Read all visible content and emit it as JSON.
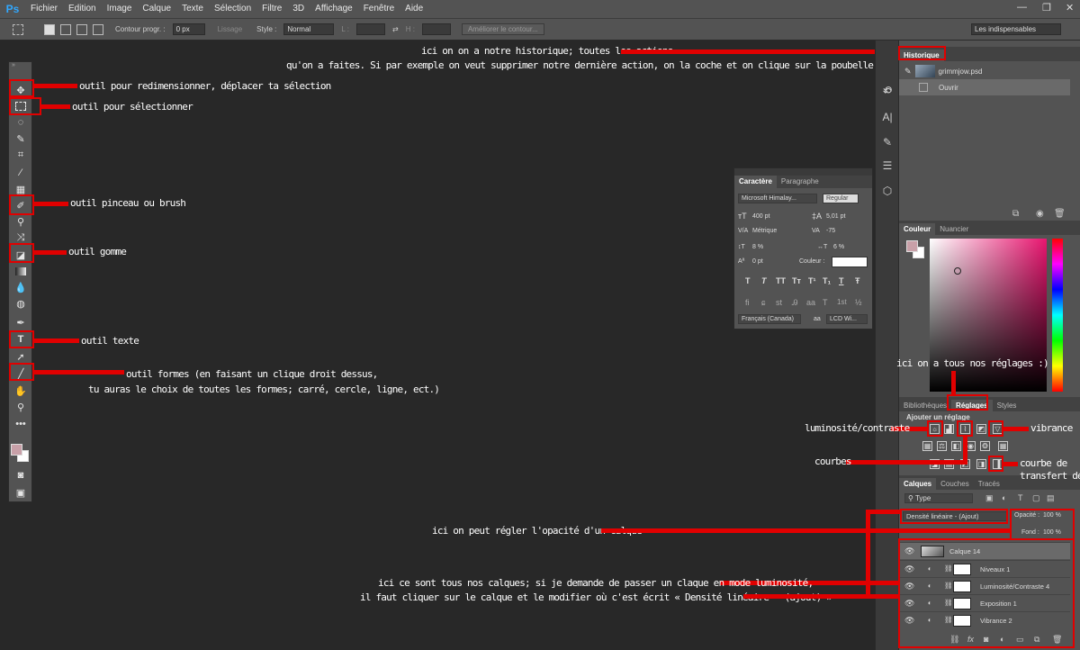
{
  "app": {
    "logo": "Ps"
  },
  "menu": [
    "Fichier",
    "Edition",
    "Image",
    "Calque",
    "Texte",
    "Sélection",
    "Filtre",
    "3D",
    "Affichage",
    "Fenêtre",
    "Aide"
  ],
  "window_controls": {
    "minimize": "—",
    "restore": "❐",
    "close": "✕"
  },
  "options_bar": {
    "feather_label": "Contour progr. :",
    "feather_value": "0 px",
    "antialias_label": "Lissage",
    "style_label": "Style :",
    "style_value": "Normal",
    "width_label": "L :",
    "height_label": "H :",
    "refine_button": "Améliorer le contour...",
    "workspace": "Les indispensables"
  },
  "annotations": {
    "move": "outil pour redimensionner, déplacer ta sélection",
    "select": "outil pour sélectionner",
    "brush": "outil pinceau ou brush",
    "eraser": "outil gomme",
    "text": "outil texte",
    "shapes_1": "outil formes (en faisant un clique droit dessus,",
    "shapes_2": "tu auras le choix de toutes les formes; carré, cercle, ligne, ect.)",
    "history_1": "ici on on a notre historique; toutes les actions",
    "history_2": "qu'on a faites. Si par exemple on veut supprimer notre dernière action, on la coche et on clique sur la poubelle.",
    "adjustments": "ici on a tous nos réglages :)",
    "brightness": "luminosité/contraste",
    "vibrance": "vibrance",
    "curves": "courbes",
    "gradient_1": "courbe de",
    "gradient_2": "transfert dégradé",
    "opacity": "ici on peut régler l'opacité d'un calque",
    "layers_1": "ici ce sont tous nos calques; si je demande de passer un claque en mode luminosité,",
    "layers_2": "il faut cliquer sur le calque et le modifier où c'est écrit « Densité linéaire - (ajout) »"
  },
  "history_panel": {
    "tab": "Historique",
    "snapshot": "grimmjow.psd",
    "rows": [
      "Ouvrir"
    ]
  },
  "character_panel": {
    "tabs": [
      "Caractère",
      "Paragraphe"
    ],
    "font": "Microsoft Himalay...",
    "style": "Regular",
    "size": "400 pt",
    "leading": "5,01 pt",
    "kerning": "Métrique",
    "tracking": "-75",
    "vscale": "8 %",
    "hscale": "6 %",
    "baseline": "0 pt",
    "color_label": "Couleur :",
    "format_buttons": [
      "T",
      "T",
      "TT",
      "Tт",
      "T¹",
      "T₁",
      "T",
      "Ŧ"
    ],
    "opentype_buttons": [
      "fi",
      "ɕ",
      "st",
      "Ꭿ",
      "aa",
      "T",
      "1st",
      "½"
    ],
    "language": "Français (Canada)",
    "aa_label": "aa",
    "antialias": "LCD Wi..."
  },
  "color_panel": {
    "tabs": [
      "Couleur",
      "Nuancier"
    ],
    "foreground": "#c8a0a8",
    "background": "#ffffff"
  },
  "adjustments_panel": {
    "tabs": [
      "Bibliothèques",
      "Réglages",
      "Styles"
    ],
    "title": "Ajouter un réglage"
  },
  "layers_panel": {
    "tabs": [
      "Calques",
      "Couches",
      "Tracés"
    ],
    "filter": "Type",
    "blend_mode": "Densité linéaire - (Ajout)",
    "opacity_label": "Opacité :",
    "opacity_value": "100 %",
    "fill_label": "Fond :",
    "fill_value": "100 %",
    "layers": [
      {
        "name": "Calque 14"
      },
      {
        "name": "Niveaux 1"
      },
      {
        "name": "Luminosité/Contraste 4"
      },
      {
        "name": "Exposition 1"
      },
      {
        "name": "Vibrance 2"
      }
    ]
  }
}
